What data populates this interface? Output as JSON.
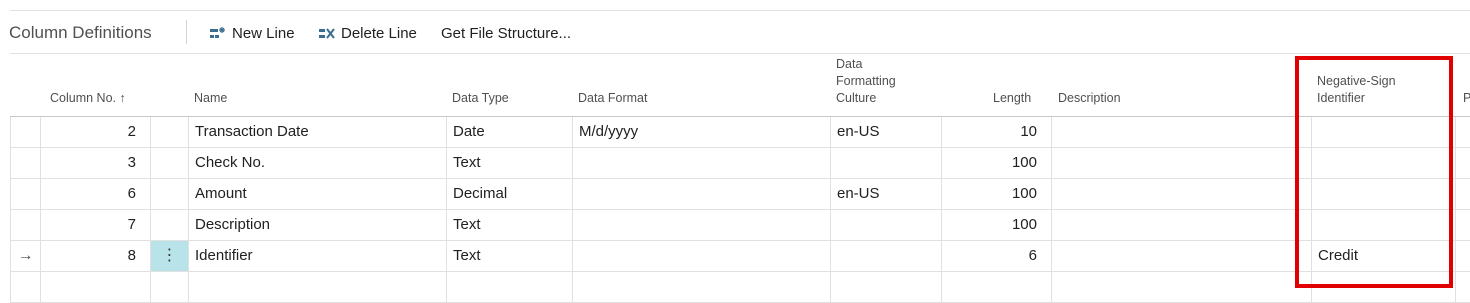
{
  "toolbar": {
    "title": "Column Definitions",
    "actions": [
      {
        "label": "New Line",
        "icon": "new-line-icon"
      },
      {
        "label": "Delete Line",
        "icon": "delete-line-icon"
      },
      {
        "label": "Get File Structure..."
      }
    ]
  },
  "columns": {
    "column_no": "Column No.",
    "sort_indicator": "↑",
    "name": "Name",
    "data_type": "Data Type",
    "data_format": "Data Format",
    "data_formatting_culture_line1": "Data",
    "data_formatting_culture_line2": "Formatting",
    "data_formatting_culture_line3": "Culture",
    "length": "Length",
    "description": "Description",
    "negative_sign_line1": "Negative-Sign",
    "negative_sign_line2": "Identifier",
    "next_truncated": "P"
  },
  "rows": [
    {
      "column_no": "2",
      "name": "Transaction Date",
      "data_type": "Date",
      "data_format": "M/d/yyyy",
      "culture": "en-US",
      "length": "10",
      "description": "",
      "negative_sign": ""
    },
    {
      "column_no": "3",
      "name": "Check No.",
      "data_type": "Text",
      "data_format": "",
      "culture": "",
      "length": "100",
      "description": "",
      "negative_sign": ""
    },
    {
      "column_no": "6",
      "name": "Amount",
      "data_type": "Decimal",
      "data_format": "",
      "culture": "en-US",
      "length": "100",
      "description": "",
      "negative_sign": ""
    },
    {
      "column_no": "7",
      "name": "Description",
      "data_type": "Text",
      "data_format": "",
      "culture": "",
      "length": "100",
      "description": "",
      "negative_sign": ""
    },
    {
      "column_no": "8",
      "name": "Identifier",
      "data_type": "Text",
      "data_format": "",
      "culture": "",
      "length": "6",
      "description": "",
      "negative_sign": "Credit",
      "current_row_arrow": "→",
      "row_menu": "⋮"
    },
    {
      "column_no": "",
      "name": "",
      "data_type": "",
      "data_format": "",
      "culture": "",
      "length": "",
      "description": "",
      "negative_sign": ""
    }
  ],
  "colors": {
    "highlight_box": "#e00000",
    "selected_menu_cell": "#b8e3e8"
  }
}
